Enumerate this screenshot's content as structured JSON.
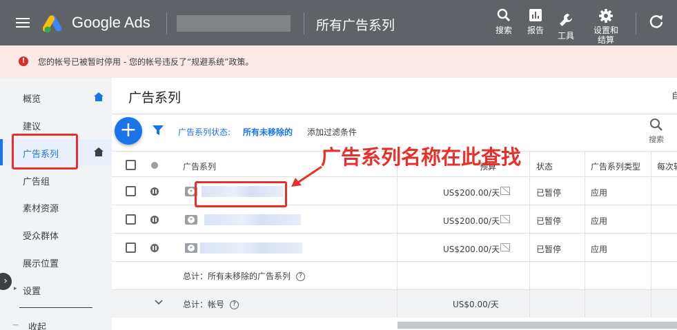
{
  "header": {
    "brand": "Google Ads",
    "page_title": "所有广告系列",
    "tools": [
      {
        "label": "搜索",
        "icon": "search-icon"
      },
      {
        "label": "报告",
        "icon": "report-icon"
      },
      {
        "label": "工具",
        "icon": "wrench-icon"
      },
      {
        "label": "设置和结算",
        "icon": "gear-icon"
      }
    ]
  },
  "banner": {
    "text": "您的帐号已被暂时停用 - 您的帐号违反了“规避系统”政策。",
    "color": "#d93025"
  },
  "sidebar": {
    "items": [
      {
        "label": "概览",
        "home": true
      },
      {
        "label": "建议"
      },
      {
        "label": "广告系列",
        "active": true,
        "home": true
      },
      {
        "label": "广告组"
      },
      {
        "label": "素材资源"
      },
      {
        "label": "受众群体"
      },
      {
        "label": "展示位置"
      },
      {
        "label": "设置"
      }
    ],
    "collapse_label": "收起"
  },
  "main": {
    "title": "广告系列",
    "right_text": "自",
    "filter_label": "广告系列状态:",
    "filter_value": "所有未移除的",
    "add_filter": "添加过滤条件",
    "search_label": "搜索",
    "columns": {
      "name": "广告系列",
      "budget": "预算",
      "status": "状态",
      "type": "广告系列类型",
      "cost": "每次转"
    },
    "rows": [
      {
        "budget": "US$200.00/天",
        "status": "已暂停",
        "type": "应用"
      },
      {
        "budget": "US$200.00/天",
        "status": "已暂停",
        "type": "应用"
      },
      {
        "budget": "US$200.00/天",
        "status": "已暂停",
        "type": "应用"
      }
    ],
    "total_label": "总计：所有未移除的广告系列",
    "account_total_label": "总计：帐号",
    "account_total_value": "US$0.00/天"
  },
  "annotation": {
    "text": "广告系列名称在此查找",
    "color": "#e8302a"
  }
}
